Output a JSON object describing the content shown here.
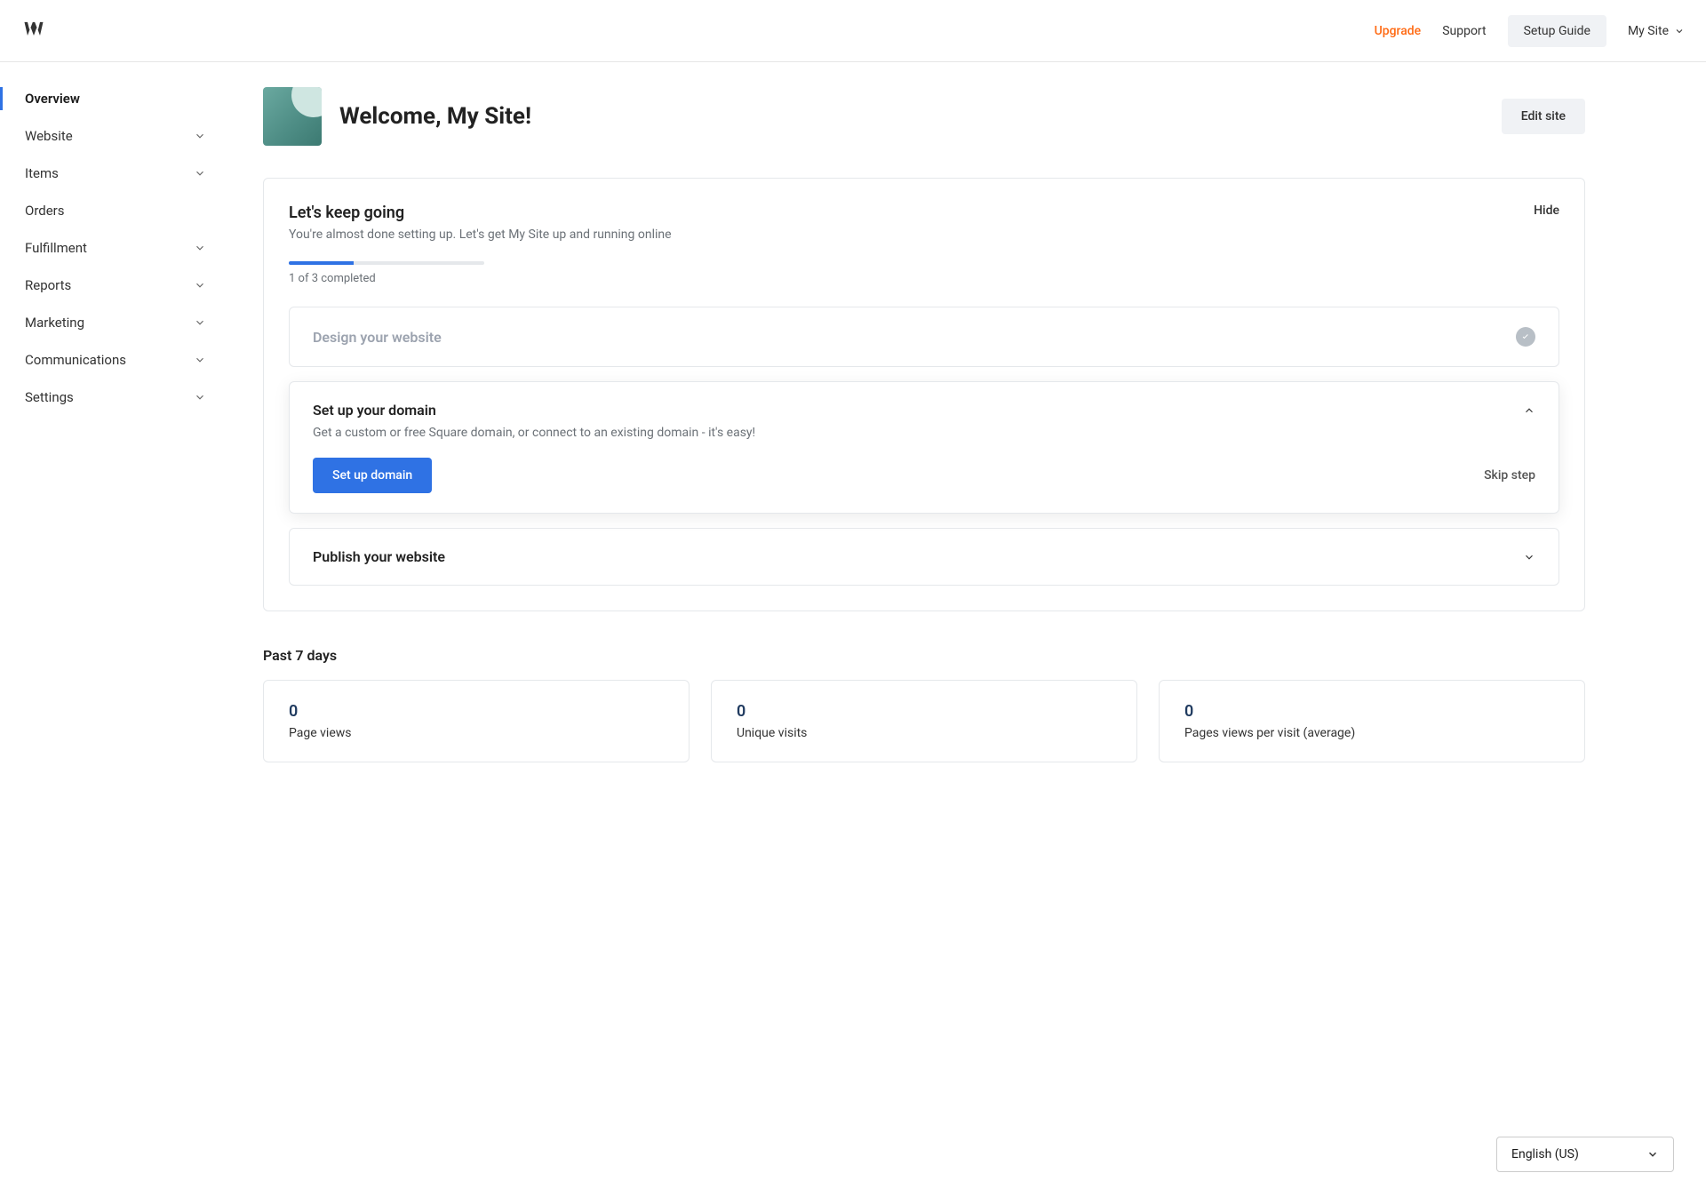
{
  "topbar": {
    "upgrade": "Upgrade",
    "support": "Support",
    "setup_guide": "Setup Guide",
    "site_name": "My Site"
  },
  "sidebar": {
    "items": [
      {
        "label": "Overview",
        "expandable": false,
        "active": true
      },
      {
        "label": "Website",
        "expandable": true,
        "active": false
      },
      {
        "label": "Items",
        "expandable": true,
        "active": false
      },
      {
        "label": "Orders",
        "expandable": false,
        "active": false
      },
      {
        "label": "Fulfillment",
        "expandable": true,
        "active": false
      },
      {
        "label": "Reports",
        "expandable": true,
        "active": false
      },
      {
        "label": "Marketing",
        "expandable": true,
        "active": false
      },
      {
        "label": "Communications",
        "expandable": true,
        "active": false
      },
      {
        "label": "Settings",
        "expandable": true,
        "active": false
      }
    ]
  },
  "welcome": {
    "title": "Welcome, My Site!",
    "edit_button": "Edit site"
  },
  "setup": {
    "title": "Let's keep going",
    "subtitle": "You're almost done setting up. Let's get My Site up and running online",
    "hide": "Hide",
    "progress_text": "1 of 3 completed",
    "progress_percent": 33.3,
    "steps": {
      "design": {
        "title": "Design your website"
      },
      "domain": {
        "title": "Set up your domain",
        "desc": "Get a custom or free Square domain, or connect to an existing domain - it's easy!",
        "button": "Set up domain",
        "skip": "Skip step"
      },
      "publish": {
        "title": "Publish your website"
      }
    }
  },
  "stats": {
    "title": "Past 7 days",
    "cards": [
      {
        "value": "0",
        "label": "Page views"
      },
      {
        "value": "0",
        "label": "Unique visits"
      },
      {
        "value": "0",
        "label": "Pages views per visit (average)"
      }
    ]
  },
  "language": "English (US)"
}
